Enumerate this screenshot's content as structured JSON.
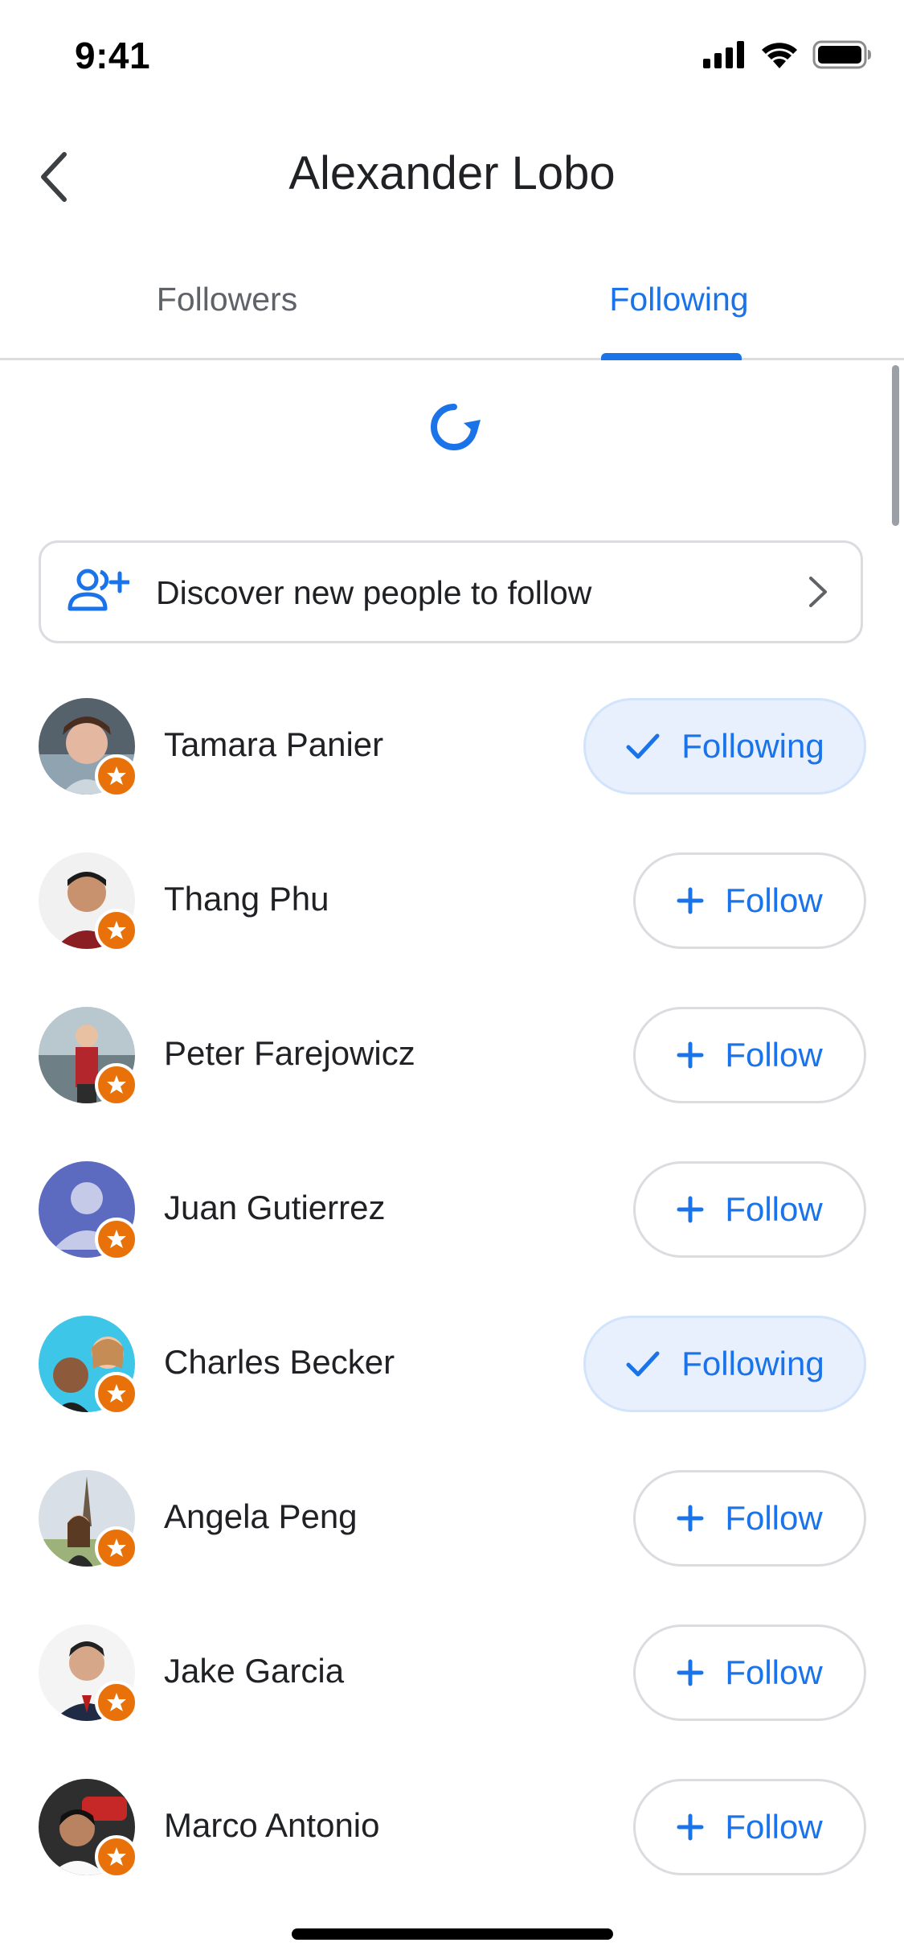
{
  "status_bar": {
    "time": "9:41",
    "icons": [
      "signal-icon",
      "wifi-icon",
      "battery-icon"
    ]
  },
  "header": {
    "title": "Alexander Lobo",
    "back_icon": "chevron-left-icon"
  },
  "tabs": [
    {
      "label": "Followers",
      "selected": false
    },
    {
      "label": "Following",
      "selected": true
    }
  ],
  "discover": {
    "label": "Discover new people to follow",
    "icon": "add-people-icon",
    "chevron": "chevron-right-icon"
  },
  "colors": {
    "accent": "#1a73e8",
    "badge": "#e8710a",
    "following_bg": "#e8f0fe"
  },
  "people": [
    {
      "name": "Tamara Panier",
      "state": "following",
      "button_label": "Following"
    },
    {
      "name": "Thang Phu",
      "state": "follow",
      "button_label": "Follow"
    },
    {
      "name": "Peter Farejowicz",
      "state": "follow",
      "button_label": "Follow"
    },
    {
      "name": "Juan Gutierrez",
      "state": "follow",
      "button_label": "Follow"
    },
    {
      "name": "Charles Becker",
      "state": "following",
      "button_label": "Following"
    },
    {
      "name": "Angela Peng",
      "state": "follow",
      "button_label": "Follow"
    },
    {
      "name": "Jake Garcia",
      "state": "follow",
      "button_label": "Follow"
    },
    {
      "name": "Marco Antonio",
      "state": "follow",
      "button_label": "Follow"
    }
  ]
}
